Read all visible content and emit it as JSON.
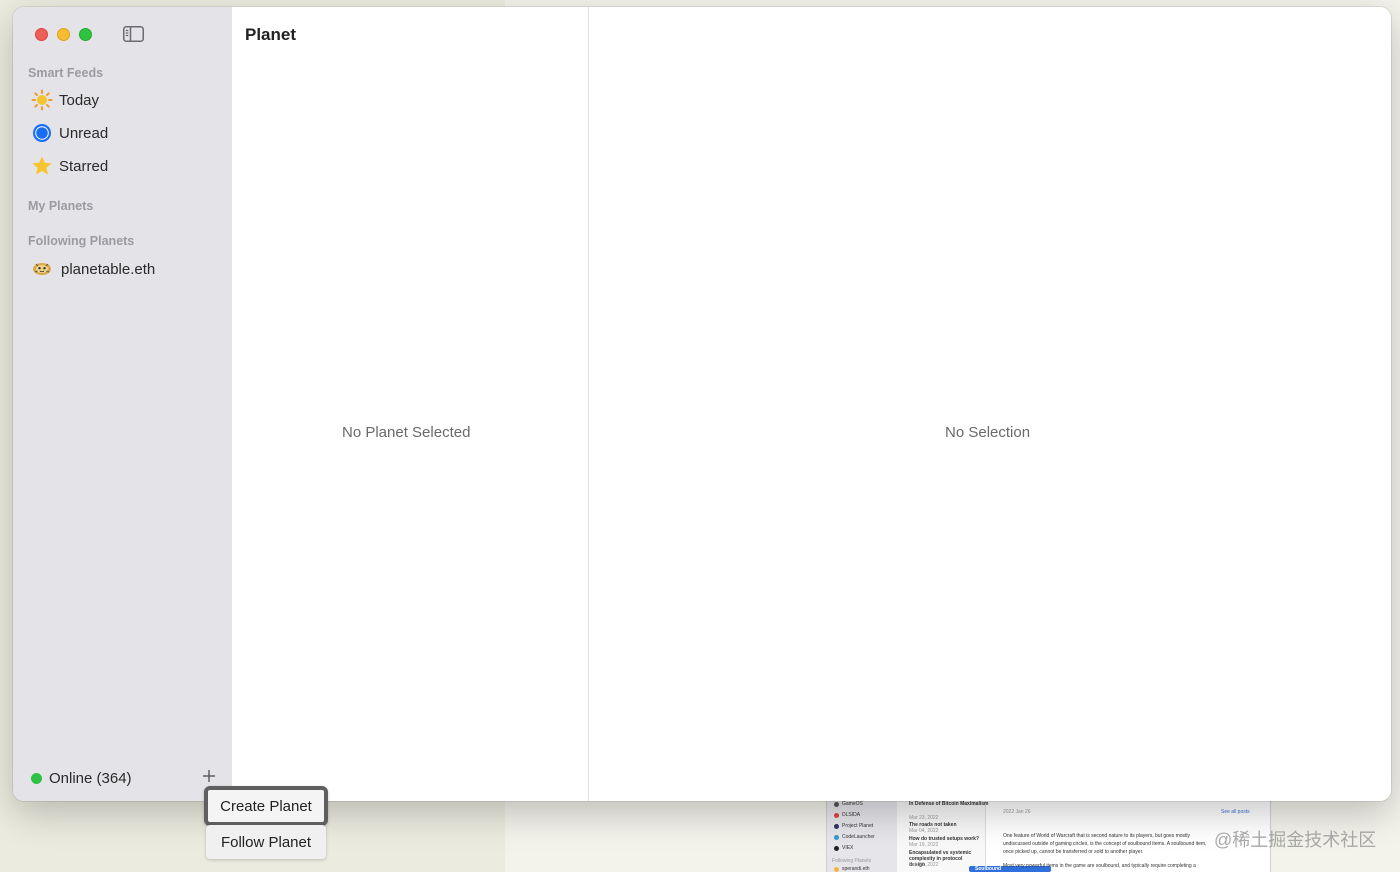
{
  "sidebar": {
    "sections": {
      "smart_feeds": "Smart Feeds",
      "my_planets": "My Planets",
      "following_planets": "Following Planets"
    },
    "smart_feeds": [
      {
        "label": "Today",
        "icon": "sun-icon"
      },
      {
        "label": "Unread",
        "icon": "unread-circle-icon"
      },
      {
        "label": "Starred",
        "icon": "star-icon"
      }
    ],
    "following": [
      {
        "label": "planetable.eth",
        "icon": "planetable-avatar-icon"
      }
    ],
    "footer": {
      "status": "Online (364)"
    }
  },
  "list_pane": {
    "title": "Planet",
    "empty": "No Planet Selected"
  },
  "detail_pane": {
    "empty": "No Selection"
  },
  "popup_menu": {
    "items": [
      "Create Planet",
      "Follow Planet"
    ]
  },
  "background_window": {
    "sidebar_items": [
      "GameOS",
      "DLSIDA",
      "Project Planet",
      "CodeLauncher",
      "VIEX"
    ],
    "sidebar_section": "Following Planets",
    "sidebar_following": "sperandi.eth",
    "articles": [
      {
        "title": "In Defense of Bitcoin Maximalism",
        "date": "Mar 23, 2022"
      },
      {
        "title": "The roads not taken",
        "date": "Mar 04, 2022"
      },
      {
        "title": "How do trusted setups work?",
        "date": "Mar 19, 2022"
      },
      {
        "title": "Encapsulated vs systemic complexity in protocol design",
        "date": "Feb 21, 2022"
      }
    ],
    "selected_article": "Soulbound",
    "detail_date": "2022 Jan 26",
    "detail_link": "See all posts",
    "detail_lines": [
      "One feature of World of Warcraft that is second nature to its players, but goes mostly",
      "undiscussed outside of gaming circles, is the concept of soulbound items. A soulbound item,",
      "once picked up, cannot be transferred or sold to another player.",
      "Most very powerful items in the game are soulbound, and typically require completing a"
    ]
  },
  "watermark": "@稀土掘金技术社区",
  "colors": {
    "close": "#ee5f57",
    "minimize": "#f5be2f",
    "maximize": "#2fc440",
    "online": "#2ec243",
    "unread_accent": "#1a6ef5",
    "star": "#f6c52d"
  }
}
